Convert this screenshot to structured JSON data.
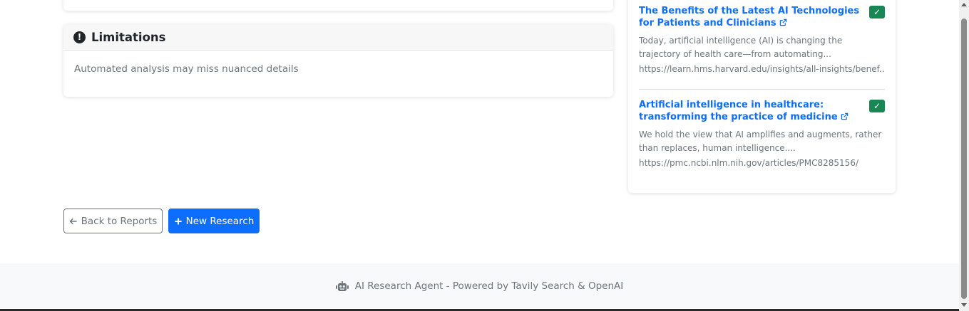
{
  "limitations": {
    "title": "Limitations",
    "text": "Automated analysis may miss nuanced details"
  },
  "sources": [
    {
      "title": "The Benefits of the Latest AI Technologies for Patients and Clinicians",
      "snippet": "Today, artificial intelligence (AI) is changing the trajectory of health care—from automating...",
      "url": "https://learn.hms.harvard.edu/insights/all-insights/benef...",
      "verified": "✓"
    },
    {
      "title": "Artificial intelligence in healthcare: transforming the practice of medicine",
      "snippet": "We hold the view that AI amplifies and augments, rather than replaces, human intelligence....",
      "url": "https://pmc.ncbi.nlm.nih.gov/articles/PMC8285156/",
      "verified": "✓"
    }
  ],
  "buttons": {
    "back_label": "Back to Reports",
    "new_label": "New Research"
  },
  "footer": {
    "text": "AI Research Agent - Powered by Tavily Search & OpenAI"
  },
  "icons": {
    "limitations": "exclamation-circle-icon",
    "external": "external-link-icon",
    "check": "check-icon",
    "back": "arrow-left-icon",
    "new": "plus-icon",
    "footer": "robot-icon"
  },
  "colors": {
    "primary": "#0d6efd",
    "success": "#198754",
    "muted": "#6c757d",
    "footer_bg": "#f8f9fa"
  }
}
